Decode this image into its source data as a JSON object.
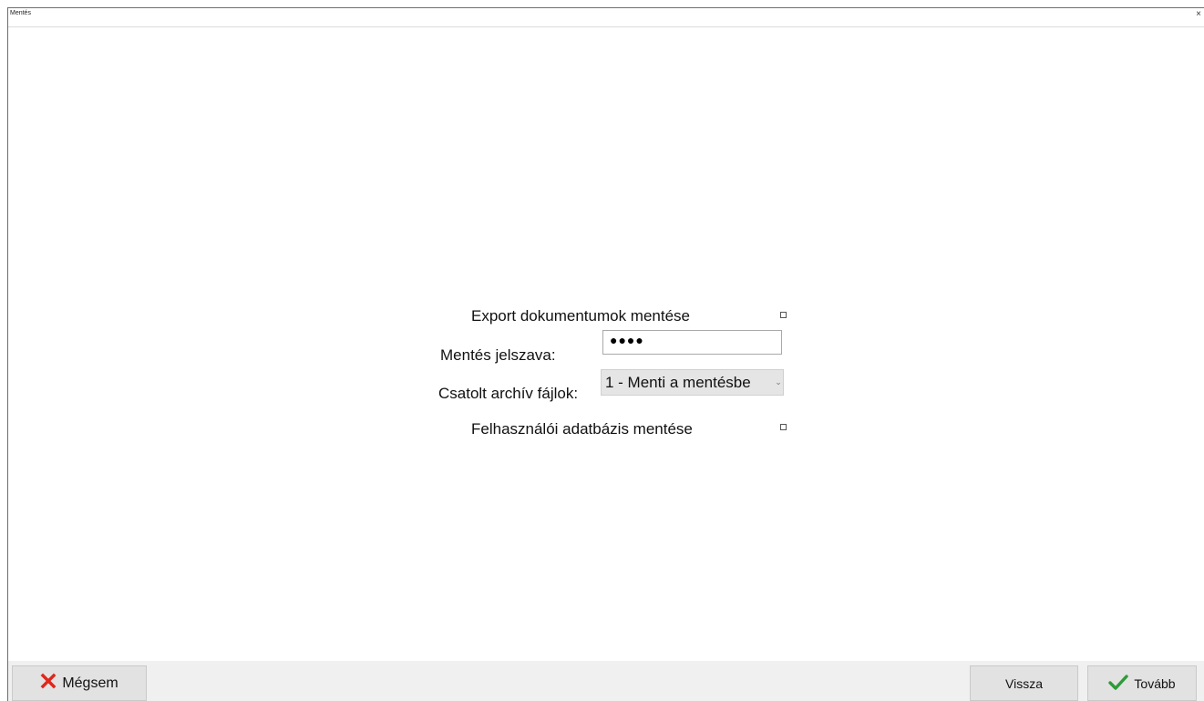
{
  "window": {
    "title": "Mentés",
    "close_glyph": "×"
  },
  "form": {
    "export_docs_label": "Export dokumentumok mentése",
    "export_docs_checked": false,
    "password_label": "Mentés jelszava:",
    "password_value": "●●●●",
    "archive_label": "Csatolt archív fájlok:",
    "archive_selected": "1 - Menti a mentésbe",
    "user_db_label": "Felhasználói adatbázis mentése",
    "user_db_checked": false
  },
  "buttons": {
    "cancel_label": "Mégsem",
    "back_label": "Vissza",
    "next_label": "Tovább"
  },
  "icons": {
    "cancel": "x-icon",
    "next": "checkmark-icon",
    "dropdown": "chevron-down-icon"
  },
  "colors": {
    "cancel_icon": "#e0261b",
    "next_icon": "#2f9a3a",
    "button_bg": "#e2e2e2",
    "footer_bg": "#f0f0f0"
  }
}
